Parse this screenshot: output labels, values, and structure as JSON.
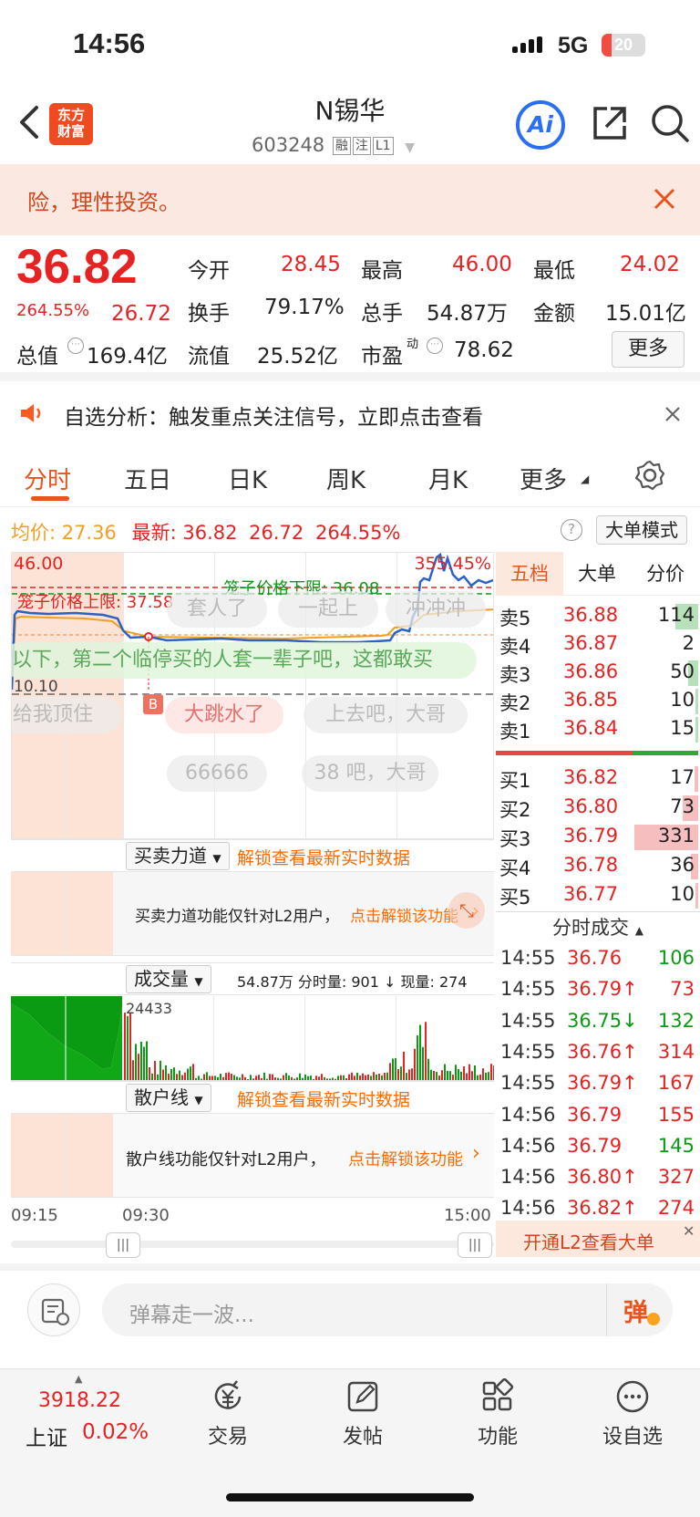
{
  "status": {
    "time": "14:56",
    "network": "5G",
    "battery": "20"
  },
  "header": {
    "logo_line1": "东方",
    "logo_line2": "财富",
    "title": "N锡华",
    "code": "603248",
    "tags": [
      "融",
      "注",
      "L1"
    ]
  },
  "banner": {
    "text": "险，理性投资。"
  },
  "quote": {
    "price": "36.82",
    "pct": "264.55%",
    "change": "26.72",
    "open_label": "今开",
    "open": "28.45",
    "high_label": "最高",
    "high": "46.00",
    "low_label": "最低",
    "low": "24.02",
    "turnover_label": "换手",
    "turnover": "79.17%",
    "volume_label": "总手",
    "volume": "54.87万",
    "amount_label": "金额",
    "amount": "15.01亿",
    "mktcap_label": "总值",
    "mktcap": "169.4亿",
    "float_label": "流值",
    "float": "25.52亿",
    "pe_label": "市盈",
    "pe_sup": "动",
    "pe": "78.62",
    "more": "更多"
  },
  "notice": {
    "text": "自选分析：触发重点关注信号，立即点击查看"
  },
  "tabs": [
    "分时",
    "五日",
    "日K",
    "周K",
    "月K",
    "更多"
  ],
  "chart_header": {
    "avg_label": "均价:",
    "avg": "27.36",
    "last_label": "最新:",
    "last": "36.82",
    "change": "26.72",
    "pct": "264.55%",
    "mode": "大单模式"
  },
  "chart": {
    "top_label": "46.00",
    "top_pct": "355.45%",
    "base_label": "10.10",
    "upper_limit": "笼子价格上限: 37.58",
    "lower_limit": "笼子价格下限: 36.08",
    "marker": "B",
    "danmu": [
      "套人了",
      "一起上",
      "冲冲冲",
      "以下，第二个临停买的人套一辈子吧，这都敢买",
      "给我顶住",
      "大跳水了",
      "上去吧，大哥",
      "66666",
      "38 吧，大哥"
    ]
  },
  "force": {
    "dropdown": "买卖力道",
    "unlock": "解锁查看最新实时数据",
    "panel_text": "买卖力道功能仅针对L2用户，",
    "panel_link": "点击解锁该功能"
  },
  "volume": {
    "dropdown": "成交量",
    "stats": "54.87万 分时量: 901 ↓ 现量: 274",
    "peak": "24433"
  },
  "retail": {
    "dropdown": "散户线",
    "unlock": "解锁查看最新实时数据",
    "panel_text": "散户线功能仅针对L2用户，",
    "panel_link": "点击解锁该功能"
  },
  "time_axis": {
    "t1": "09:15",
    "t2": "09:30",
    "t3": "15:00"
  },
  "orderbook": {
    "tabs": [
      "五档",
      "大单",
      "分价"
    ],
    "asks": [
      {
        "label": "卖5",
        "price": "36.88",
        "vol": "114",
        "bar": 0.18
      },
      {
        "label": "卖4",
        "price": "36.87",
        "vol": "2",
        "bar": 0
      },
      {
        "label": "卖3",
        "price": "36.86",
        "vol": "50",
        "bar": 0.08
      },
      {
        "label": "卖2",
        "price": "36.85",
        "vol": "10",
        "bar": 0.02
      },
      {
        "label": "卖1",
        "price": "36.84",
        "vol": "15",
        "bar": 0.02
      }
    ],
    "bids": [
      {
        "label": "买1",
        "price": "36.82",
        "vol": "17",
        "bar": 0.03
      },
      {
        "label": "买2",
        "price": "36.80",
        "vol": "73",
        "bar": 0.12
      },
      {
        "label": "买3",
        "price": "36.79",
        "vol": "331",
        "bar": 0.5
      },
      {
        "label": "买4",
        "price": "36.78",
        "vol": "36",
        "bar": 0.06
      },
      {
        "label": "买5",
        "price": "36.77",
        "vol": "10",
        "bar": 0.02
      }
    ],
    "ticks_title": "分时成交",
    "ticks": [
      {
        "t": "14:55",
        "p": "36.76",
        "dir": "",
        "v": "106",
        "vc": "green"
      },
      {
        "t": "14:55",
        "p": "36.79",
        "dir": "↑",
        "v": "73",
        "vc": "red"
      },
      {
        "t": "14:55",
        "p": "36.75",
        "dir": "↓",
        "v": "132",
        "vc": "green"
      },
      {
        "t": "14:55",
        "p": "36.76",
        "dir": "↑",
        "v": "314",
        "vc": "red"
      },
      {
        "t": "14:55",
        "p": "36.79",
        "dir": "↑",
        "v": "167",
        "vc": "red"
      },
      {
        "t": "14:56",
        "p": "36.79",
        "dir": "",
        "v": "155",
        "vc": "red"
      },
      {
        "t": "14:56",
        "p": "36.79",
        "dir": "",
        "v": "145",
        "vc": "green"
      },
      {
        "t": "14:56",
        "p": "36.80",
        "dir": "↑",
        "v": "327",
        "vc": "red"
      },
      {
        "t": "14:56",
        "p": "36.82",
        "dir": "↑",
        "v": "274",
        "vc": "red"
      }
    ],
    "l2": "开通L2查看大单"
  },
  "danmu_input": {
    "placeholder": "弹幕走一波...",
    "send": "弹"
  },
  "bottom": {
    "index_value": "3918.22",
    "index_name": "上证",
    "index_pct": "0.02%",
    "nav": [
      "交易",
      "发帖",
      "功能",
      "设自选"
    ]
  }
}
